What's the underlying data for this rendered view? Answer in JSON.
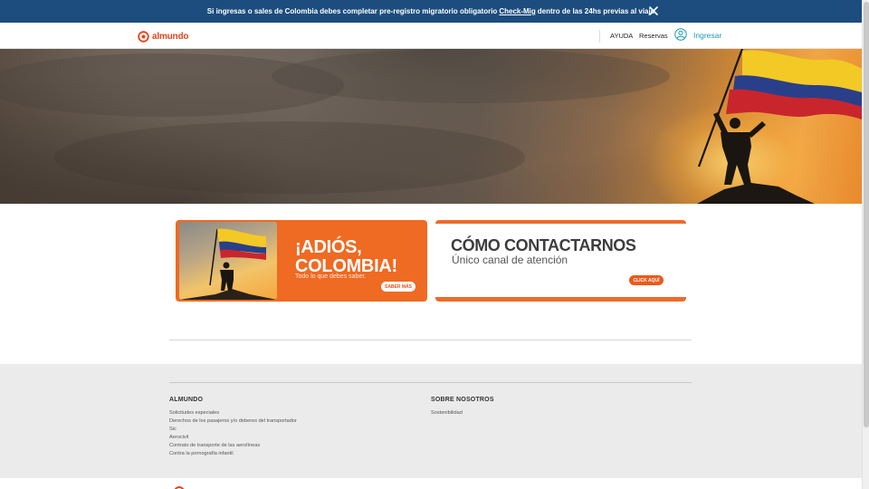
{
  "banner": {
    "text_before": "Si ingresas o sales de Colombia debes completar pre-registro migratorio obligatorio",
    "link": "Check-Mig",
    "text_after": "dentro de las 24hs previas al viaje",
    "close_icon": "close-icon",
    "bg_color": "#1c4d7e"
  },
  "header": {
    "logo_text": "almundo",
    "nav": {
      "help": "AYUDA",
      "reservas": "Reservas",
      "login": "Ingresar"
    },
    "brand_color": "#e8431a",
    "login_color": "#1b9ab8"
  },
  "promos": {
    "left": {
      "title_line1": "¡ADIÓS,",
      "title_line2": "COLOMBIA!",
      "subtitle": "Todo lo que debes saber.",
      "button": "SABER MÁS",
      "color": "#ef6a22"
    },
    "right": {
      "title": "CÓMO CONTACTARNOS",
      "subtitle": "Único canal de atención",
      "button": "CLICK AQUÍ"
    }
  },
  "footer": {
    "col1": {
      "heading": "ALMUNDO",
      "links": [
        "Solicitudes especiales",
        "Derechos de los pasajeros y/o deberes del transportador",
        "Sic",
        "Aerocivil",
        "Contrato de transporte de las aerolíneas",
        "Contra la pornografía infantil"
      ]
    },
    "col2": {
      "heading": "SOBRE NOSOTROS",
      "links": [
        "Sostenibilidad"
      ]
    }
  }
}
